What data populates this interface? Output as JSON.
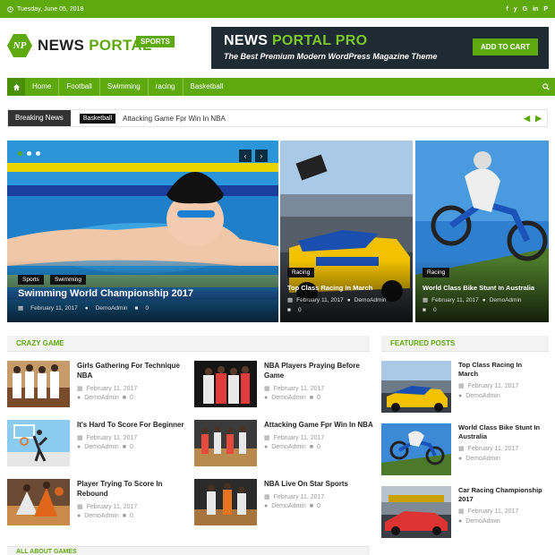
{
  "topbar": {
    "date": "Tuesday, June 05, 2018",
    "socials": [
      "f",
      "y",
      "G",
      "in",
      "P"
    ]
  },
  "header": {
    "logo_mark": "NP",
    "logo_news": "NEWS",
    "logo_portal": "PORTAL",
    "logo_badge": "SPORTS",
    "banner_title_1": "NEWS",
    "banner_title_2": "PORTAL PRO",
    "banner_subtitle": "The Best Premium Modern WordPress Magazine Theme",
    "banner_button": "ADD TO CART"
  },
  "nav": {
    "items": [
      "Home",
      "Football",
      "Swimming",
      "racing",
      "Basketball"
    ]
  },
  "breaking": {
    "label": "Breaking News",
    "tag": "Basketball",
    "headline": "Attacking Game Fpr Win In NBA"
  },
  "slider": {
    "main": {
      "cats": [
        "Sports",
        "Swimming"
      ],
      "title": "Swimming World Championship 2017",
      "date": "February 11, 2017",
      "author": "DemoAdmin",
      "comments": "0"
    },
    "side": [
      {
        "cat": "Racing",
        "title": "Top Class Racing In March",
        "date": "February 11, 2017",
        "author": "DemoAdmin",
        "comments": "0"
      },
      {
        "cat": "Racing",
        "title": "World Class Bike Stunt In Australia",
        "date": "February 11, 2017",
        "author": "DemoAdmin",
        "comments": "0"
      }
    ]
  },
  "crazy_game": {
    "heading": "CRAZY GAME",
    "posts": [
      {
        "title": "Girls Gathering For Technique NBA",
        "date": "February 11, 2017",
        "author": "DemoAdmin",
        "comments": "0"
      },
      {
        "title": "NBA Players Praying Before Game",
        "date": "February 11, 2017",
        "author": "DemoAdmin",
        "comments": "0"
      },
      {
        "title": "It's Hard To Score For Beginner",
        "date": "February 11, 2017",
        "author": "DemoAdmin",
        "comments": "0"
      },
      {
        "title": "Attacking Game Fpr Win In NBA",
        "date": "February 11, 2017",
        "author": "DemoAdmin",
        "comments": "0"
      },
      {
        "title": "Player Trying To Score In Rebound",
        "date": "February 11, 2017",
        "author": "DemoAdmin",
        "comments": "0"
      },
      {
        "title": "NBA Live On Star Sports",
        "date": "February 11, 2017",
        "author": "DemoAdmin",
        "comments": "0"
      }
    ]
  },
  "featured": {
    "heading": "FEATURED POSTS",
    "posts": [
      {
        "title": "Top Class Racing In March",
        "date": "February 11, 2017",
        "author": "DemoAdmin"
      },
      {
        "title": "World Class Bike Stunt In Australia",
        "date": "February 11, 2017",
        "author": "DemoAdmin"
      },
      {
        "title": "Car Racing Championship 2017",
        "date": "February 11, 2017",
        "author": "DemoAdmin"
      }
    ]
  },
  "bottom": {
    "heading": "ALL ABOUT GAMES"
  },
  "colors": {
    "accent": "#5eaa0e",
    "dark": "#1f2b33"
  }
}
